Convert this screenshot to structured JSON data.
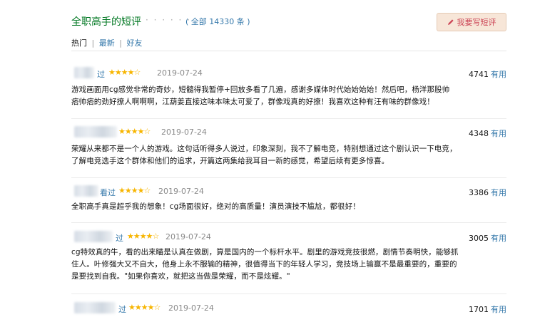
{
  "header": {
    "title": "全职高手的短评",
    "dots": "· · · · · ·",
    "total_link": "( 全部 14330 条 )",
    "write_button": "我要写短评"
  },
  "tabs": [
    {
      "label": "热门",
      "active": true
    },
    {
      "label": "最新",
      "active": false
    },
    {
      "label": "好友",
      "active": false
    }
  ],
  "separator": "|",
  "reviews": [
    {
      "user": "过",
      "stars": "★★★★☆",
      "date": "2019-07-24",
      "votes": "4741",
      "vote_label": "有用",
      "lines": [
        "游戏画面用cg感觉非常的奇妙，短髓得我暂停+回放多看了几遍，感谢多媒体时代始始始始！然后吧，杨洋那股帅",
        "痞帅痞的劲好撩人啊啊啊，江葫姜直接这味本味太可爱了，群像戏真的好撩！我喜欢这种有汪有味的群像戏！"
      ]
    },
    {
      "user": "",
      "stars": "★★★★☆",
      "date": "2019-07-24",
      "votes": "4348",
      "vote_label": "有用",
      "lines": [
        "荣耀从来都不是一个人的游戏。这句话听得多人说过，印象深刻，我不了解电竞，特别想通过这个剧认识一下电竞，",
        "了解电竞选手这个群体和他们的追求，开篇这两集给我耳目一新的感觉，希望后续有更多惊喜。"
      ]
    },
    {
      "user": "看过",
      "stars": "★★★★☆",
      "date": "2019-07-24",
      "votes": "3386",
      "vote_label": "有用",
      "lines": [
        "全职高手真是超乎我的想象！cg场面很好，绝对的高质量！演员演技不尴尬，都很好！"
      ]
    },
    {
      "user": "过",
      "stars": "★★★★☆",
      "date": "2019-07-24",
      "votes": "3005",
      "vote_label": "有用",
      "lines": [
        "cg特效真的牛，看的出来瞄是认真在做剧，算是国内的一个标杆水平。剧里的游戏竞技很燃，剧情节奏明快，能够抓",
        "住人。叶修强大又不自大，他身上永不服输的精神，很值得当下的年轻人学习，竞技场上输赢不是最重要的，重要的",
        "是要找到自我。\"如果你喜欢，就把这当做是荣耀，而不是炫耀。\""
      ]
    },
    {
      "user": "过",
      "stars": "★★★★☆",
      "date": "2019-07-24",
      "votes": "1701",
      "vote_label": "有用",
      "lines": []
    }
  ],
  "colors": {
    "title_green": "#007722",
    "link_blue": "#3377aa",
    "star_gold": "#f7b500",
    "button_bg": "#f7e6d8"
  },
  "icons": {
    "write_button_icon": "pencil-icon"
  }
}
